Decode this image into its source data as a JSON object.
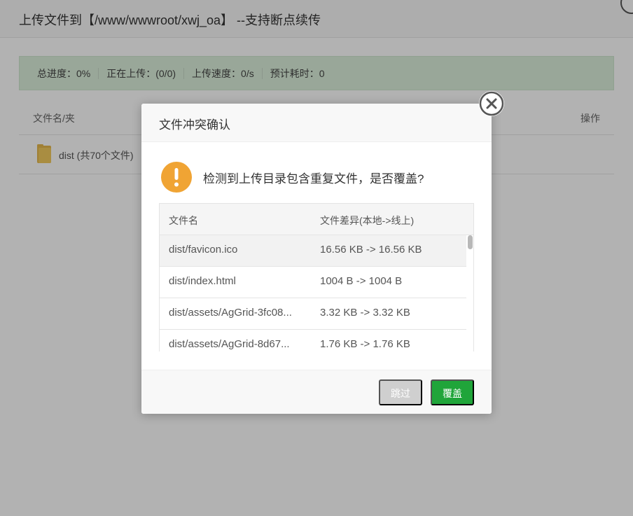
{
  "upload_window": {
    "title": "上传文件到【/www/wwwroot/xwj_oa】 --支持断点续传",
    "progress": {
      "total": "总进度：0%",
      "uploading": "正在上传：(0/0)",
      "speed": "上传速度：0/s",
      "eta": "预计耗时：0"
    },
    "columns": {
      "name": "文件名/夹",
      "operation": "操作"
    },
    "files": [
      {
        "name": "dist (共70个文件)"
      }
    ]
  },
  "dialog": {
    "title": "文件冲突确认",
    "message": "检测到上传目录包含重复文件，是否覆盖?",
    "table": {
      "col_name": "文件名",
      "col_diff": "文件差异(本地->线上)",
      "rows": [
        {
          "name": "dist/favicon.ico",
          "diff": "16.56 KB -> 16.56 KB"
        },
        {
          "name": "dist/index.html",
          "diff": "1004 B -> 1004 B"
        },
        {
          "name": "dist/assets/AgGrid-3fc08...",
          "diff": "3.32 KB -> 3.32 KB"
        },
        {
          "name": "dist/assets/AgGrid-8d67...",
          "diff": "1.76 KB -> 1.76 KB"
        }
      ]
    },
    "buttons": {
      "skip": "跳过",
      "cover": "覆盖"
    }
  },
  "colors": {
    "accent_green": "#20a53a",
    "warning_orange": "#f0a434",
    "progress_bg": "#dcf0dc",
    "skip_button": "#cfcfcf"
  },
  "icons": {
    "dialog_close": "close-circle-icon",
    "warning": "exclamation-icon",
    "folder": "folder-icon"
  }
}
